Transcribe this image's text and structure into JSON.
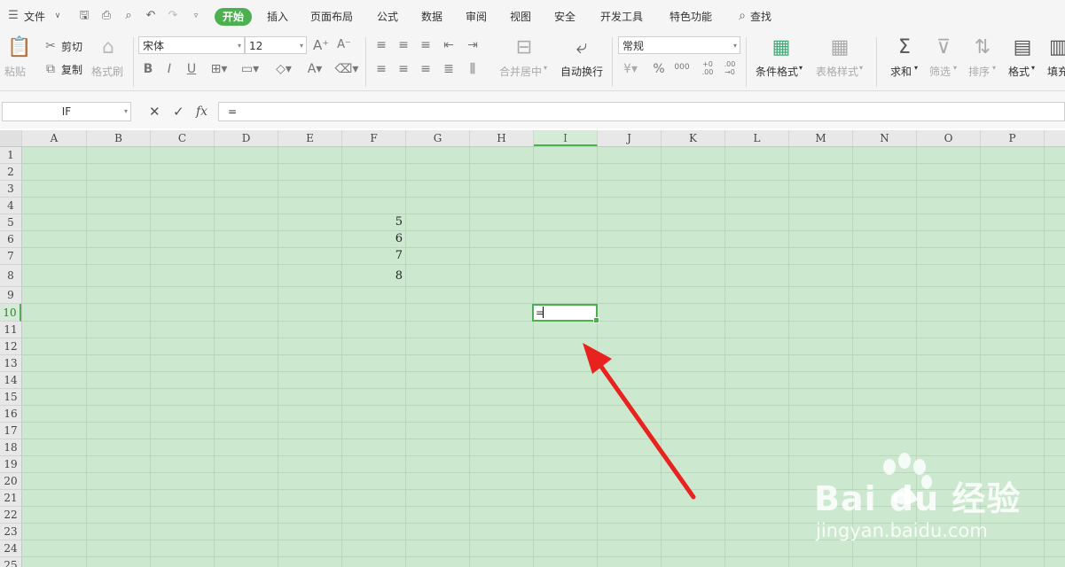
{
  "menubar": {
    "file_label": "文件",
    "tabs": [
      "开始",
      "插入",
      "页面布局",
      "公式",
      "数据",
      "审阅",
      "视图",
      "安全",
      "开发工具",
      "特色功能"
    ],
    "active_tab": "开始",
    "search_label": "查找"
  },
  "ribbon": {
    "cut": "剪切",
    "copy": "复制",
    "paste": "粘贴",
    "format_painter": "格式刷",
    "font_name": "宋体",
    "font_size": "12",
    "merge_center": "合并居中",
    "wrap_text": "自动换行",
    "number_format": "常规",
    "percent": "%",
    "thousands": "000",
    "dec_add": "+0 .00",
    "dec_remove": ".00 →0",
    "cond_format": "条件格式",
    "table_style": "表格样式",
    "sum": "求和",
    "filter": "筛选",
    "sort": "排序",
    "format": "格式",
    "fill": "填充"
  },
  "formulabar": {
    "name_box": "IF",
    "fx": "fx",
    "formula": "="
  },
  "sheet": {
    "columns": [
      "A",
      "B",
      "C",
      "D",
      "E",
      "F",
      "G",
      "H",
      "I",
      "J",
      "K",
      "L",
      "M",
      "N",
      "O",
      "P"
    ],
    "selected_column": "I",
    "rows": [
      "1",
      "2",
      "3",
      "4",
      "5",
      "6",
      "7",
      "8",
      "9",
      "10",
      "11",
      "12",
      "13",
      "14",
      "15",
      "16",
      "17",
      "18",
      "19",
      "20",
      "21",
      "22",
      "23",
      "24",
      "25"
    ],
    "selected_row": "10",
    "cells": [
      {
        "ref": "F5",
        "value": "5"
      },
      {
        "ref": "F6",
        "value": "6"
      },
      {
        "ref": "F7",
        "value": "7"
      },
      {
        "ref": "F8",
        "value": "8"
      }
    ],
    "active_cell": {
      "ref": "I10",
      "content": "="
    }
  },
  "watermark": {
    "brand": "Bai du 经验",
    "url": "jingyan.baidu.com"
  },
  "colors": {
    "accent": "#4caf50",
    "grid_background": "#cce8cf",
    "arrow": "#e8231f"
  }
}
